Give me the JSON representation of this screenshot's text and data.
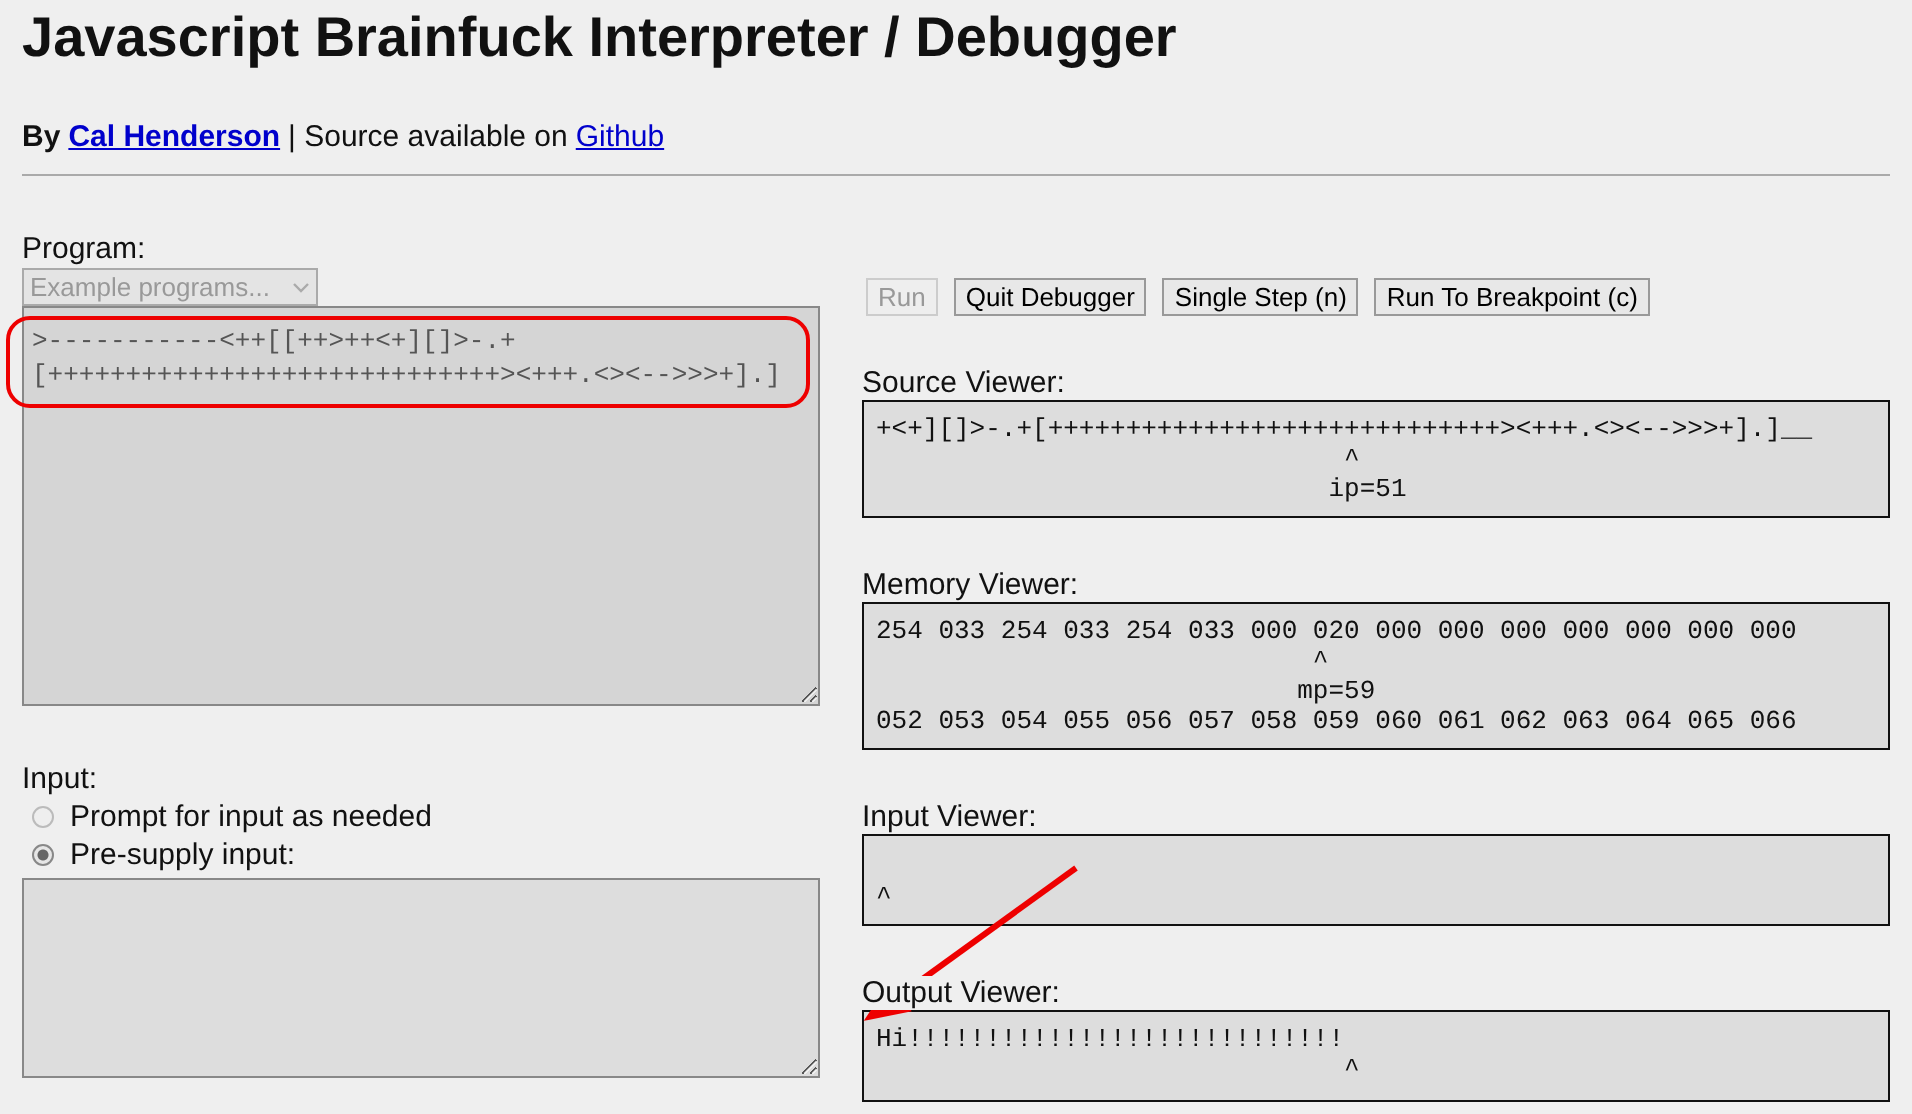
{
  "title": "Javascript Brainfuck Interpreter / Debugger",
  "byline": {
    "prefix": "By",
    "author": "Cal Henderson",
    "middle": "| Source available on",
    "source": "Github"
  },
  "program": {
    "label": "Program:",
    "examples": {
      "placeholder": "Example programs...",
      "disabled": true
    },
    "code": ">-----------<++[[++>++<+][]>-.+\n[+++++++++++++++++++++++++++++><+++.<><-->>>+].]",
    "disabled": true
  },
  "input": {
    "label": "Input:",
    "options": [
      {
        "label": "Prompt for input as needed",
        "selected": false
      },
      {
        "label": "Pre-supply input:",
        "selected": true
      }
    ]
  },
  "buttons": [
    {
      "label": "Run",
      "disabled": true
    },
    {
      "label": "Quit Debugger",
      "disabled": false
    },
    {
      "label": "Single Step (n)",
      "disabled": false
    },
    {
      "label": "Run To Breakpoint (c)",
      "disabled": false
    }
  ],
  "viewers": [
    {
      "kind": "source",
      "label": "Source Viewer:",
      "lines": [
        "+<+][]>-.+[+++++++++++++++++++++++++++++><+++.<><-->>>+].]__",
        "                              ^",
        "                             ip=51"
      ]
    },
    {
      "kind": "memory",
      "label": "Memory Viewer:",
      "lines": [
        "254 033 254 033 254 033 000 020 000 000 000 000 000 000 000",
        "                            ^",
        "                           mp=59",
        "052 053 054 055 056 057 058 059 060 061 062 063 064 065 066"
      ]
    },
    {
      "kind": "input",
      "label": "Input Viewer:",
      "lines": [
        "^"
      ]
    },
    {
      "kind": "output",
      "label": "Output Viewer:",
      "lines": [
        "Hi!!!!!!!!!!!!!!!!!!!!!!!!!!!!",
        "                              ^"
      ]
    }
  ]
}
